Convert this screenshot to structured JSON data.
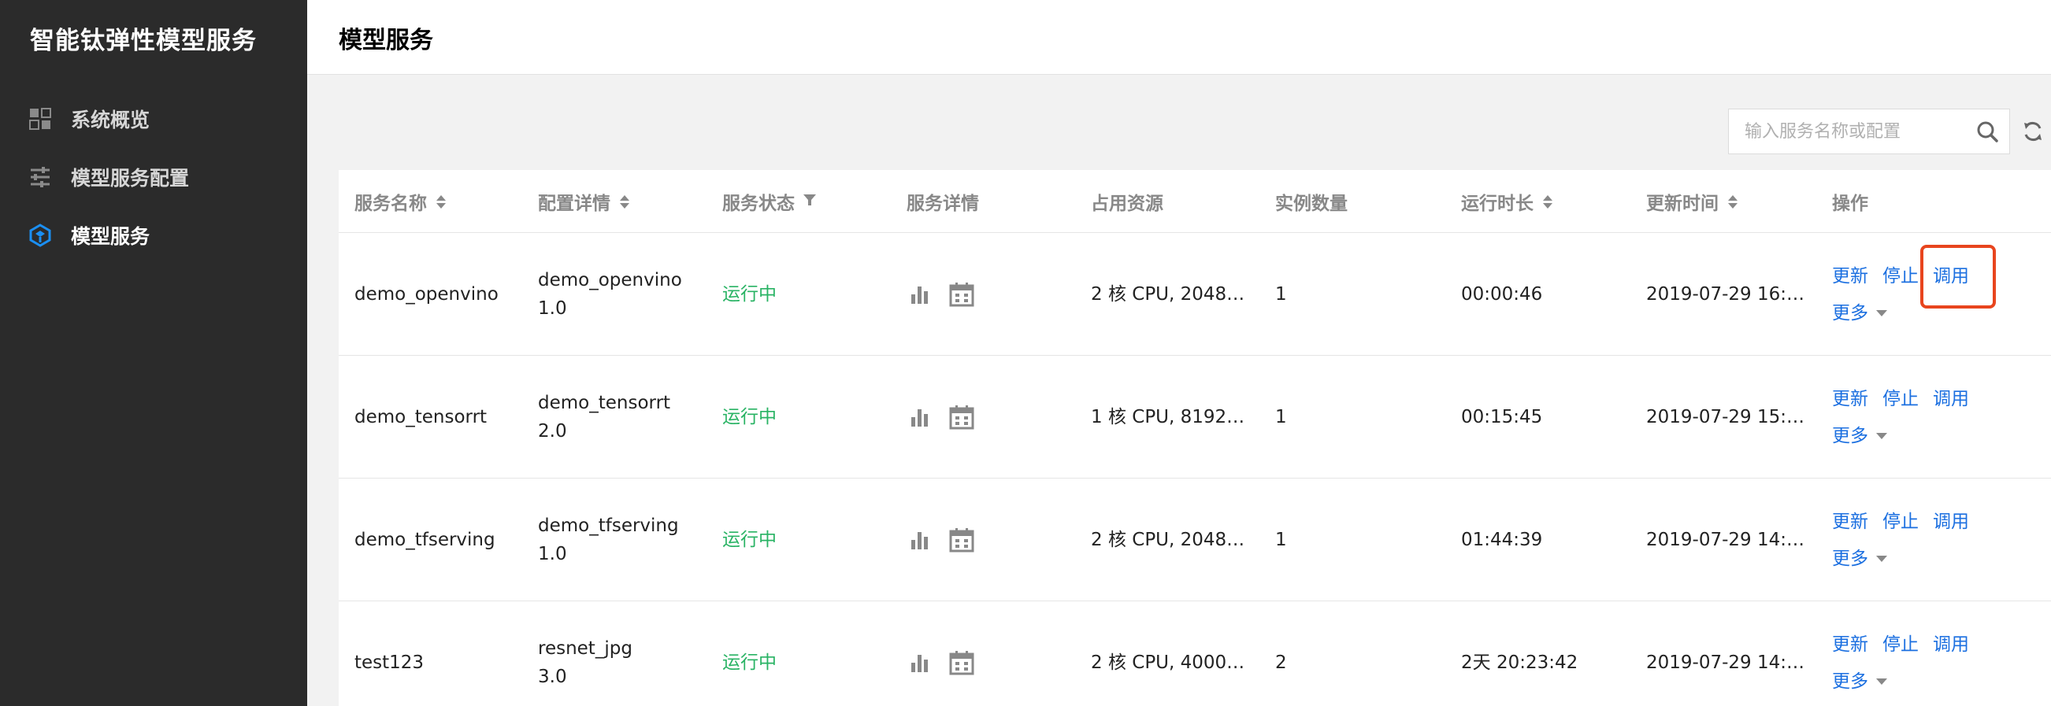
{
  "app": {
    "title": "智能钛弹性模型服务"
  },
  "sidebar": {
    "items": [
      {
        "label": "系统概览",
        "icon": "dashboard-grid-icon",
        "active": false
      },
      {
        "label": "模型服务配置",
        "icon": "sliders-icon",
        "active": false
      },
      {
        "label": "模型服务",
        "icon": "model-service-icon",
        "active": true
      }
    ]
  },
  "header": {
    "title": "模型服务"
  },
  "search": {
    "placeholder": "输入服务名称或配置",
    "value": ""
  },
  "table": {
    "columns": [
      "服务名称",
      "配置详情",
      "服务状态",
      "服务详情",
      "占用资源",
      "实例数量",
      "运行时长",
      "更新时间",
      "操作"
    ],
    "rows": [
      {
        "name": "demo_openvino",
        "config_name": "demo_openvino",
        "config_version": "1.0",
        "status": "运行中",
        "resources": "2 核 CPU, 2048…",
        "instances": "1",
        "uptime": "00:00:46",
        "updated": "2019-07-29 16:…"
      },
      {
        "name": "demo_tensorrt",
        "config_name": "demo_tensorrt",
        "config_version": "2.0",
        "status": "运行中",
        "resources": "1 核 CPU, 8192…",
        "instances": "1",
        "uptime": "00:15:45",
        "updated": "2019-07-29 15:…"
      },
      {
        "name": "demo_tfserving",
        "config_name": "demo_tfserving",
        "config_version": "1.0",
        "status": "运行中",
        "resources": "2 核 CPU, 2048…",
        "instances": "1",
        "uptime": "01:44:39",
        "updated": "2019-07-29 14:…"
      },
      {
        "name": "test123",
        "config_name": "resnet_jpg",
        "config_version": "3.0",
        "status": "运行中",
        "resources": "2 核 CPU, 4000…",
        "instances": "2",
        "uptime": "2天 20:23:42",
        "updated": "2019-07-29 14:…"
      }
    ],
    "actions": {
      "update": "更新",
      "stop": "停止",
      "invoke": "调用",
      "more": "更多"
    }
  },
  "colors": {
    "sidebar_bg": "#2b2b2b",
    "link": "#1b6fe0",
    "running": "#29b364",
    "highlight": "#e8451e",
    "active_icon": "#1b8ff2"
  }
}
